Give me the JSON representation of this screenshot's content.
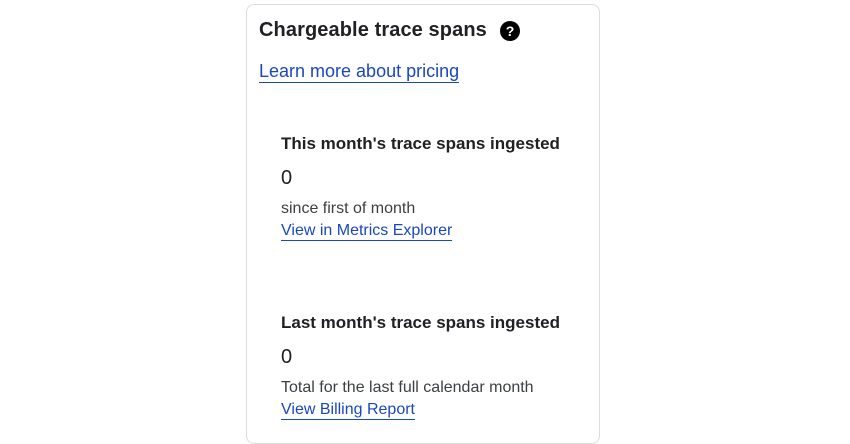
{
  "card": {
    "title": "Chargeable trace spans",
    "help_icon": "help-circle-icon",
    "pricing_link": "Learn more about pricing",
    "metrics": [
      {
        "label": "This month's trace spans ingested",
        "value": "0",
        "description": "since first of month",
        "link": "View in Metrics Explorer"
      },
      {
        "label": "Last month's trace spans ingested",
        "value": "0",
        "description": "Total for the last full calendar month",
        "link": "View Billing Report"
      }
    ]
  },
  "colors": {
    "link": "#1a47c0",
    "text": "#202124",
    "secondary_text": "#3c4043",
    "border": "#dadce0"
  }
}
